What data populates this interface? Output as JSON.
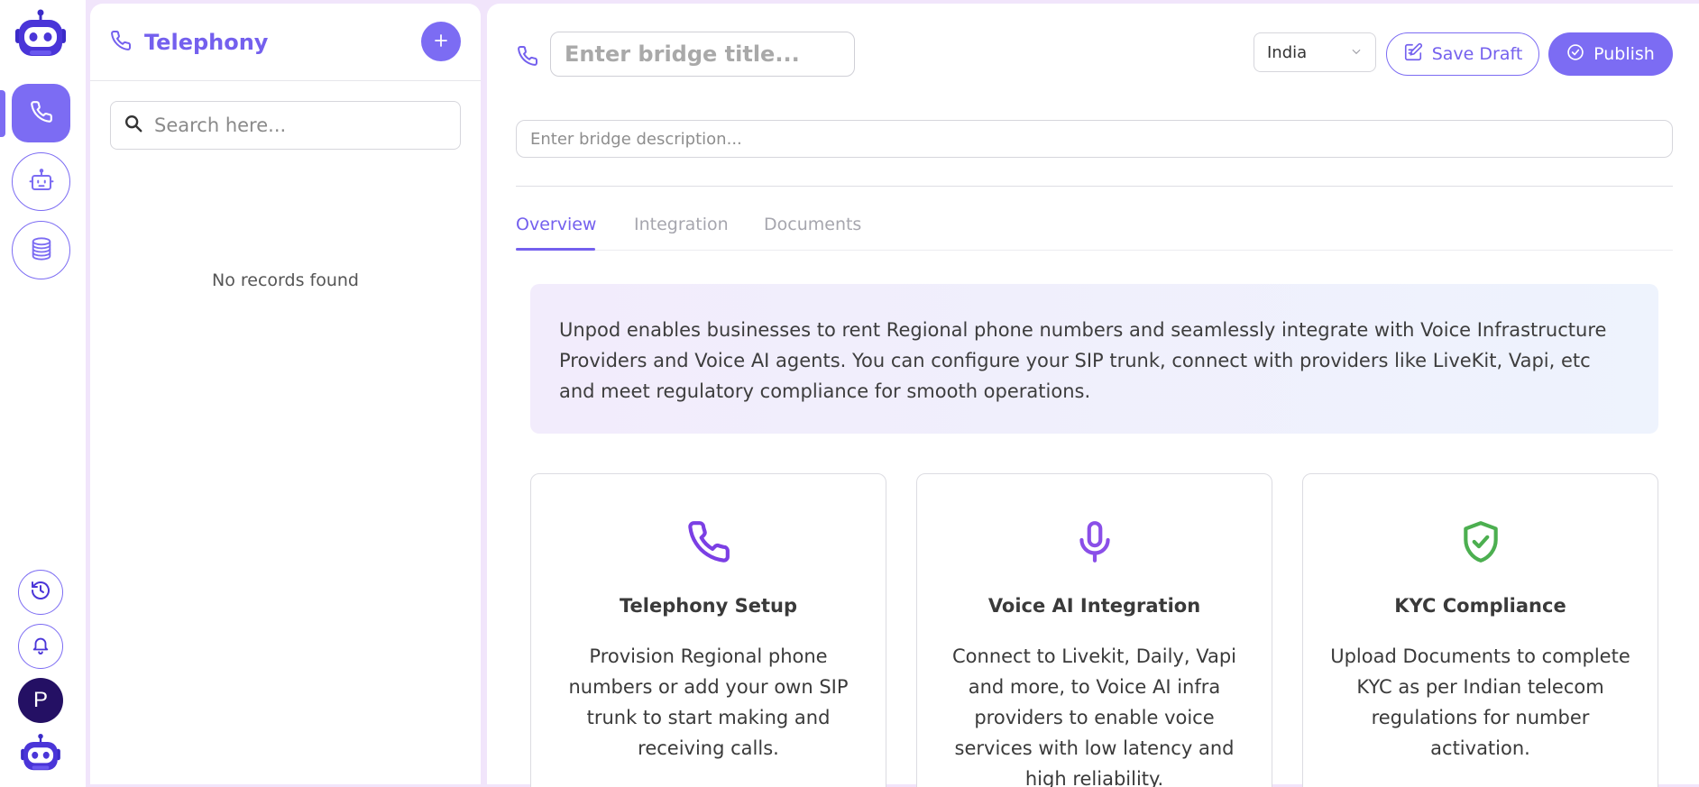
{
  "sidebar": {
    "logo_icon": "robot-logo-icon",
    "items": [
      {
        "name": "telephony",
        "icon": "phone-icon",
        "active": true
      },
      {
        "name": "agents",
        "icon": "robot-icon",
        "active": false
      },
      {
        "name": "data",
        "icon": "database-icon",
        "active": false
      }
    ],
    "bottom": {
      "history_icon": "history-icon",
      "notifications_icon": "bell-icon",
      "avatar_initial": "P",
      "assistant_icon": "robot-icon"
    }
  },
  "list_panel": {
    "title": "Telephony",
    "add_icon": "plus-icon",
    "search": {
      "placeholder": "Search here...",
      "value": ""
    },
    "empty_text": "No records found"
  },
  "editor": {
    "title_placeholder": "Enter bridge title...",
    "title_value": "",
    "country": "India",
    "save_draft_label": "Save Draft",
    "publish_label": "Publish",
    "description_placeholder": "Enter bridge description...",
    "tabs": [
      {
        "label": "Overview",
        "active": true
      },
      {
        "label": "Integration",
        "active": false
      },
      {
        "label": "Documents",
        "active": false
      }
    ],
    "banner_text": "Unpod enables businesses to rent Regional phone numbers and seamlessly integrate with Voice Infrastructure Providers and Voice AI agents. You can configure your SIP trunk, connect with providers like LiveKit, Vapi, etc and meet regulatory compliance for smooth operations.",
    "cards": [
      {
        "icon": "phone-icon",
        "title": "Telephony Setup",
        "text": "Provision Regional phone numbers or add your own SIP trunk to start making and receiving calls."
      },
      {
        "icon": "microphone-icon",
        "title": "Voice AI Integration",
        "text": "Connect to Livekit, Daily, Vapi and more, to Voice AI infra providers to enable voice services with low latency and high reliability."
      },
      {
        "icon": "shield-check-icon",
        "title": "KYC Compliance",
        "text": "Upload Documents to complete KYC as per Indian telecom regulations for number activation."
      }
    ]
  },
  "colors": {
    "accent": "#7c6cf3",
    "accent_text": "#7460ee",
    "phone_icon": "#7b3fe4",
    "mic_icon": "#8a4fe8",
    "shield_icon": "#4caf50",
    "avatar_bg": "#241064"
  }
}
